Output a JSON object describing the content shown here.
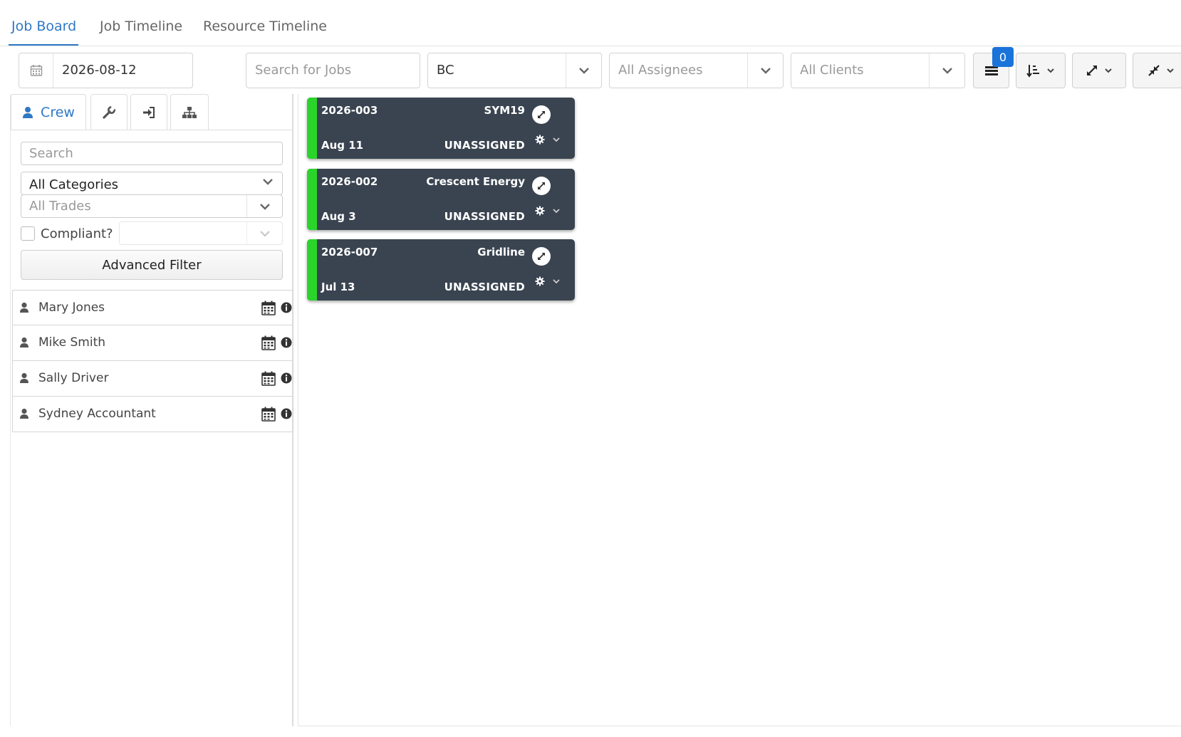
{
  "tabs": [
    {
      "label": "Job Board",
      "active": true
    },
    {
      "label": "Job Timeline",
      "active": false
    },
    {
      "label": "Resource Timeline",
      "active": false
    }
  ],
  "toolbar": {
    "date": "2026-08-12",
    "search_placeholder": "Search for Jobs",
    "region": "BC",
    "assignees": "All Assignees",
    "clients": "All Clients",
    "badge_count": "0"
  },
  "sidebar": {
    "tabs": [
      {
        "label": "Crew",
        "icon": "person-icon",
        "active": true
      },
      {
        "label": "",
        "icon": "wrench-icon",
        "active": false
      },
      {
        "label": "",
        "icon": "sign-in-icon",
        "active": false
      },
      {
        "label": "",
        "icon": "sitemap-icon",
        "active": false
      }
    ],
    "search_placeholder": "Search",
    "category": "All Categories",
    "trades_placeholder": "All Trades",
    "compliant_label": "Compliant?",
    "advanced_filter_label": "Advanced Filter",
    "crew": [
      {
        "name": "Mary Jones"
      },
      {
        "name": "Mike Smith"
      },
      {
        "name": "Sally Driver"
      },
      {
        "name": "Sydney Accountant"
      }
    ]
  },
  "jobs": [
    {
      "number": "2026-003",
      "client": "SYM19",
      "date": "Aug 11",
      "status": "UNASSIGNED"
    },
    {
      "number": "2026-002",
      "client": "Crescent Energy",
      "date": "Aug 3",
      "status": "UNASSIGNED"
    },
    {
      "number": "2026-007",
      "client": "Gridline",
      "date": "Jul 13",
      "status": "UNASSIGNED"
    }
  ],
  "colors": {
    "accent": "#2f78c4",
    "badge": "#1a73d9",
    "card_bg": "#3a4451",
    "card_stripe": "#2bd42b"
  }
}
